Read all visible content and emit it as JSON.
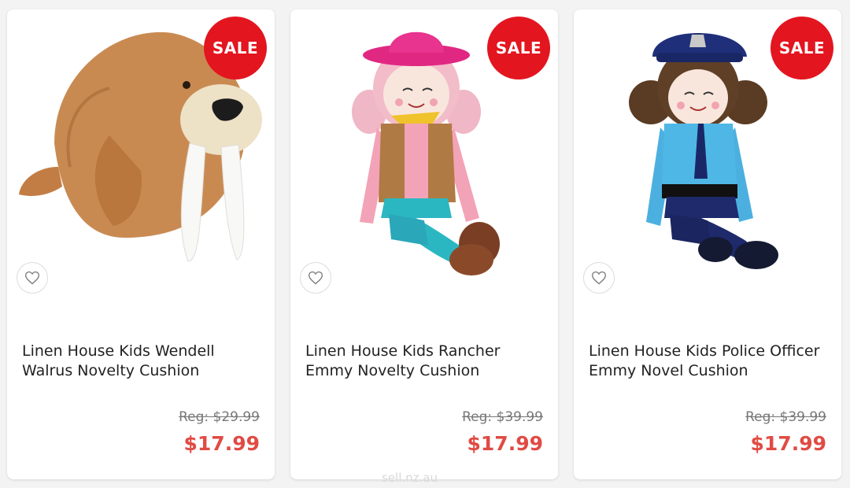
{
  "products": [
    {
      "badge": "SALE",
      "title": "Linen House Kids Wendell Walrus Novelty Cushion",
      "reg_price": "Reg: $29.99",
      "sale_price": "$17.99",
      "image_icon": "walrus-cushion-image"
    },
    {
      "badge": "SALE",
      "title": "Linen House Kids Rancher Emmy Novelty Cushion",
      "reg_price": "Reg: $39.99",
      "sale_price": "$17.99",
      "image_icon": "cowgirl-doll-image"
    },
    {
      "badge": "SALE",
      "title": "Linen House Kids Police Officer Emmy Novel Cushion",
      "reg_price": "Reg: $39.99",
      "sale_price": "$17.99",
      "image_icon": "police-doll-image"
    }
  ],
  "colors": {
    "sale_badge": "#e3151f",
    "sale_price": "#e04b44",
    "reg_price": "#777777"
  },
  "watermark": "sell.nz.au"
}
